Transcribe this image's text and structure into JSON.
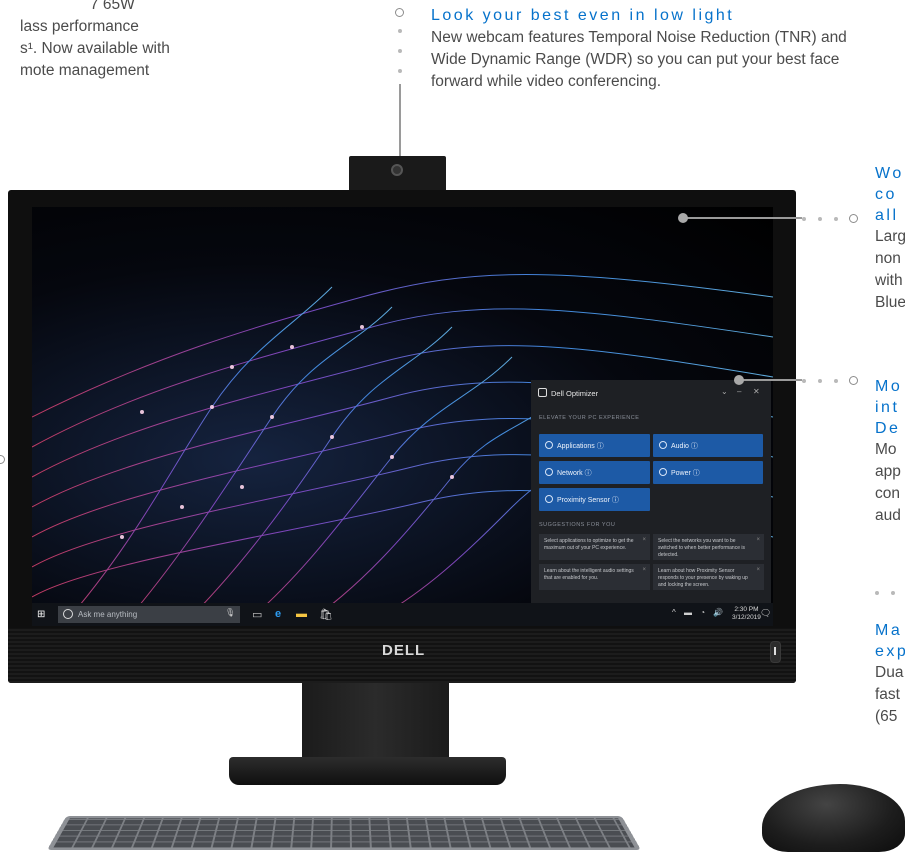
{
  "callouts": {
    "left_top": {
      "line1": "7 65W",
      "line2": "lass performance",
      "line3": "s¹. Now available with",
      "line4": "mote management"
    },
    "webcam": {
      "title": "Look your best even in low light",
      "body": "New webcam features Temporal Noise Reduction (TNR) and Wide Dynamic Range (WDR) so you can put your best face forward while video conferencing."
    },
    "right_display": {
      "title_1": "Wo",
      "title_2": "co",
      "title_3": "all",
      "body_1": "Larg",
      "body_2": "non",
      "body_3": "with",
      "body_4": "Blue"
    },
    "right_optimizer": {
      "title_1": "Mo",
      "title_2": "int",
      "title_3": "De",
      "body_1": "Mo",
      "body_2": "app",
      "body_3": "con",
      "body_4": "aud"
    },
    "right_bottom": {
      "title_1": "Ma",
      "title_2": "exp",
      "body_1": "Dua",
      "body_2": "fast",
      "body_3": "(65"
    }
  },
  "monitor": {
    "brand": "DELL"
  },
  "optimizer": {
    "title": "Dell Optimizer",
    "section_elevate": "ELEVATE YOUR PC EXPERIENCE",
    "tiles": [
      {
        "label": "Applications ⓘ"
      },
      {
        "label": "Audio ⓘ"
      },
      {
        "label": "Network ⓘ"
      },
      {
        "label": "Power ⓘ"
      },
      {
        "label": "Proximity Sensor ⓘ"
      }
    ],
    "section_suggestions": "SUGGESTIONS FOR YOU",
    "cards": [
      {
        "text": "Select applications to optimize to get the maximum out of your PC experience."
      },
      {
        "text": "Select the networks you want to be switched to when better performance is detected."
      },
      {
        "text": "Learn about the intelligent audio settings that are enabled for you."
      },
      {
        "text": "Learn about how Proximity Sensor responds to your presence by waking up and locking the screen."
      }
    ]
  },
  "taskbar": {
    "search_placeholder": "Ask me anything",
    "time": "2:30 PM",
    "date": "3/12/2019"
  },
  "colors": {
    "accent_blue": "#0672cb",
    "tile_blue": "#1d5aa6"
  }
}
